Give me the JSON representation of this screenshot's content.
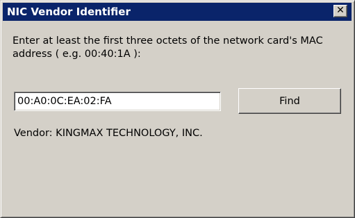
{
  "window": {
    "title": "NIC Vendor Identifier",
    "close_glyph": "✕",
    "close_icon": "close-icon"
  },
  "form": {
    "instructions": "Enter at least the first three octets of the network card's MAC address ( e.g. 00:40:1A ):",
    "mac_value": "00:A0:0C:EA:02:FA",
    "find_label": "Find"
  },
  "result": {
    "vendor_text": "Vendor: KINGMAX TECHNOLOGY, INC."
  },
  "colors": {
    "titlebar": "#0a246a",
    "face": "#d4d0c8"
  }
}
